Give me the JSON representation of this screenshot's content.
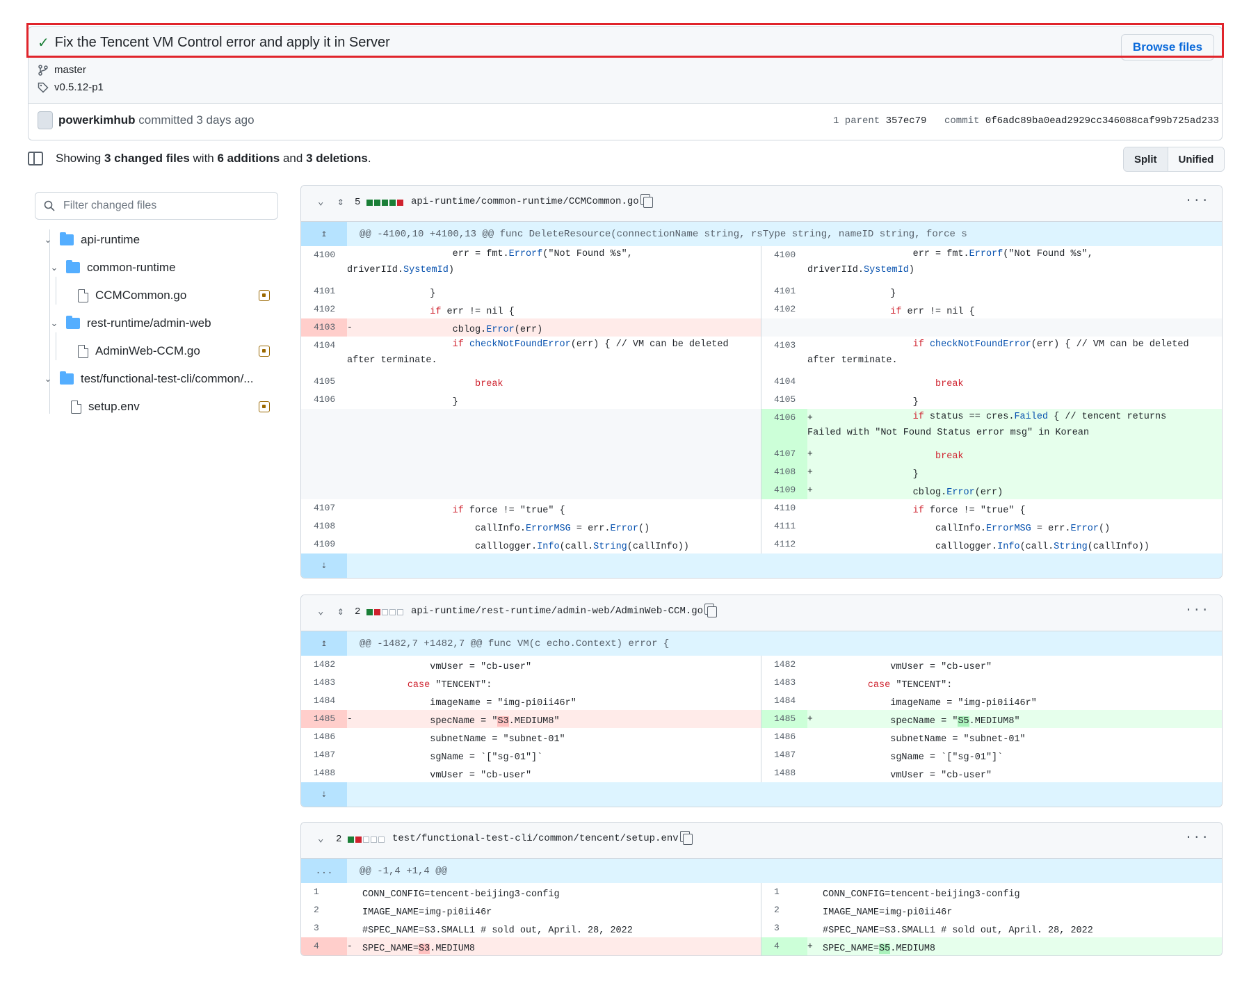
{
  "commit": {
    "title": "Fix the Tencent VM Control error and apply it in Server",
    "browse_label": "Browse files",
    "branch": "master",
    "tag": "v0.5.12-p1",
    "author": "powerkimhub",
    "committed_text": "committed 3 days ago",
    "parent_label": "1 parent",
    "parent_sha": "357ec79",
    "commit_label": "commit",
    "commit_sha": "0f6adc89ba0ead2929cc346088caf99b725ad233"
  },
  "summary": {
    "prefix": "Showing",
    "changed": "3 changed files",
    "with": "with",
    "additions": "6 additions",
    "and": "and",
    "deletions": "3 deletions",
    "suffix": "."
  },
  "view_toggle": {
    "split": "Split",
    "unified": "Unified",
    "active": "split"
  },
  "sidebar": {
    "filter_placeholder": "Filter changed files",
    "tree": [
      {
        "type": "folder",
        "label": "api-runtime"
      },
      {
        "type": "folder",
        "label": "common-runtime"
      },
      {
        "type": "file",
        "label": "CCMCommon.go",
        "status": "modified"
      },
      {
        "type": "folder",
        "label": "rest-runtime/admin-web"
      },
      {
        "type": "file",
        "label": "AdminWeb-CCM.go",
        "status": "modified"
      },
      {
        "type": "folder",
        "label": "test/functional-test-cli/common/..."
      },
      {
        "type": "file",
        "label": "setup.env",
        "status": "modified"
      }
    ]
  },
  "files": [
    {
      "count": "5",
      "path": "api-runtime/common-runtime/CCMCommon.go",
      "hunk": "@@ -4100,10 +4100,13 @@ func DeleteResource(connectionName string, rsType string, nameID string, force s",
      "rows": [
        {
          "l_no": "4100",
          "l_code": "                err = fmt.Errorf(\"Not Found %s\",",
          "l_code2": "driverIId.SystemId)",
          "r_no": "4100",
          "r_code": "                err = fmt.Errorf(\"Not Found %s\",",
          "r_code2": "driverIId.SystemId)"
        },
        {
          "l_no": "4101",
          "l_code": "            }",
          "r_no": "4101",
          "r_code": "            }"
        },
        {
          "l_no": "4102",
          "l_code": "            if err != nil {",
          "r_no": "4102",
          "r_code": "            if err != nil {"
        },
        {
          "l_no": "4103",
          "l_code": "                cblog.Error(err)",
          "l_type": "del",
          "r_type": "empty"
        },
        {
          "l_no": "4104",
          "l_code": "                if checkNotFoundError(err) { // VM can be deleted",
          "l_code2": "after terminate.",
          "r_no": "4103",
          "r_code": "                if checkNotFoundError(err) { // VM can be deleted",
          "r_code2": "after terminate."
        },
        {
          "l_no": "4105",
          "l_code": "                    break",
          "r_no": "4104",
          "r_code": "                    break"
        },
        {
          "l_no": "4106",
          "l_code": "                }",
          "r_no": "4105",
          "r_code": "                }"
        },
        {
          "l_type": "empty",
          "r_no": "4106",
          "r_code": "                if status == cres.Failed { // tencent returns",
          "r_code2": "Failed with \"Not Found Status error msg\" in Korean",
          "r_type": "add"
        },
        {
          "l_type": "empty",
          "r_no": "4107",
          "r_code": "                    break",
          "r_type": "add"
        },
        {
          "l_type": "empty",
          "r_no": "4108",
          "r_code": "                }",
          "r_type": "add"
        },
        {
          "l_type": "empty",
          "r_no": "4109",
          "r_code": "                cblog.Error(err)",
          "r_type": "add"
        },
        {
          "l_no": "4107",
          "l_code": "                if force != \"true\" {",
          "r_no": "4110",
          "r_code": "                if force != \"true\" {"
        },
        {
          "l_no": "4108",
          "l_code": "                    callInfo.ErrorMSG = err.Error()",
          "r_no": "4111",
          "r_code": "                    callInfo.ErrorMSG = err.Error()"
        },
        {
          "l_no": "4109",
          "l_code": "                    calllogger.Info(call.String(callInfo))",
          "r_no": "4112",
          "r_code": "                    calllogger.Info(call.String(callInfo))"
        }
      ]
    },
    {
      "count": "2",
      "path": "api-runtime/rest-runtime/admin-web/AdminWeb-CCM.go",
      "hunk": "@@ -1482,7 +1482,7 @@ func VM(c echo.Context) error {",
      "rows": [
        {
          "l_no": "1482",
          "l_code": "            vmUser = \"cb-user\"",
          "r_no": "1482",
          "r_code": "            vmUser = \"cb-user\""
        },
        {
          "l_no": "1483",
          "l_code": "        case \"TENCENT\":",
          "r_no": "1483",
          "r_code": "        case \"TENCENT\":"
        },
        {
          "l_no": "1484",
          "l_code": "            imageName = \"img-pi0ii46r\"",
          "r_no": "1484",
          "r_code": "            imageName = \"img-pi0ii46r\""
        },
        {
          "l_no": "1485",
          "l_code": "            specName = \"S3.MEDIUM8\"",
          "l_type": "del",
          "r_no": "1485",
          "r_code": "            specName = \"S5.MEDIUM8\"",
          "r_type": "add"
        },
        {
          "l_no": "1486",
          "l_code": "            subnetName = \"subnet-01\"",
          "r_no": "1486",
          "r_code": "            subnetName = \"subnet-01\""
        },
        {
          "l_no": "1487",
          "l_code": "            sgName = `[\"sg-01\"]`",
          "r_no": "1487",
          "r_code": "            sgName = `[\"sg-01\"]`"
        },
        {
          "l_no": "1488",
          "l_code": "            vmUser = \"cb-user\"",
          "r_no": "1488",
          "r_code": "            vmUser = \"cb-user\""
        }
      ]
    },
    {
      "count": "2",
      "path": "test/functional-test-cli/common/tencent/setup.env",
      "hunk": "@@ -1,4 +1,4 @@",
      "rows": [
        {
          "l_no": "1",
          "l_code": "CONN_CONFIG=tencent-beijing3-config",
          "r_no": "1",
          "r_code": "CONN_CONFIG=tencent-beijing3-config"
        },
        {
          "l_no": "2",
          "l_code": "IMAGE_NAME=img-pi0ii46r",
          "r_no": "2",
          "r_code": "IMAGE_NAME=img-pi0ii46r"
        },
        {
          "l_no": "3",
          "l_code": "#SPEC_NAME=S3.SMALL1 # sold out, April. 28, 2022",
          "r_no": "3",
          "r_code": "#SPEC_NAME=S3.SMALL1 # sold out, April. 28, 2022"
        },
        {
          "l_no": "4",
          "l_code": "SPEC_NAME=S3.MEDIUM8",
          "l_type": "del",
          "r_no": "4",
          "r_code": "SPEC_NAME=S5.MEDIUM8",
          "r_type": "add"
        }
      ]
    }
  ],
  "colors": {
    "add": "#1a7f37",
    "del": "#cf222e",
    "link": "#0969da",
    "highlight_border": "#e0242b"
  },
  "icons": [
    "check-icon",
    "branch-icon",
    "tag-icon",
    "avatar",
    "file-tree-toggle-icon",
    "search-icon",
    "folder-icon",
    "file-icon",
    "modified-icon",
    "chevron-down-icon",
    "expand-icon",
    "copy-icon",
    "more-icon"
  ]
}
